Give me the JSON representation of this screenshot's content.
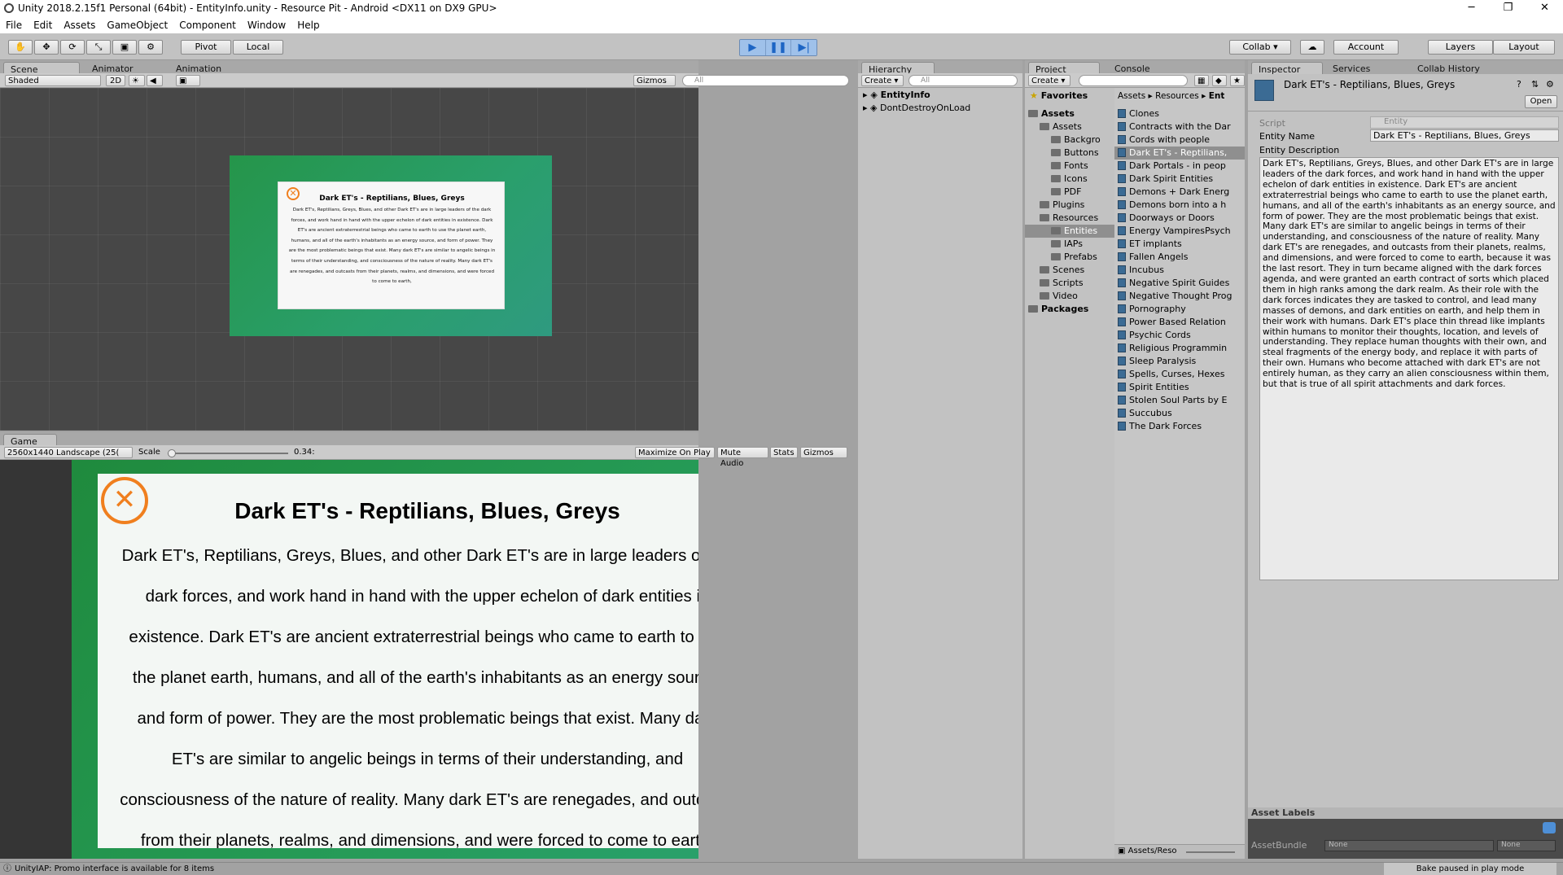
{
  "window": {
    "title": "Unity 2018.2.15f1 Personal (64bit) - EntityInfo.unity - Resource Pit - Android <DX11 on DX9 GPU>",
    "minimize": "─",
    "maximize": "❐",
    "close": "✕"
  },
  "menu": [
    "File",
    "Edit",
    "Assets",
    "GameObject",
    "Component",
    "Window",
    "Help"
  ],
  "toolbar": {
    "tools": [
      "✋",
      "✥",
      "⟳",
      "⤡",
      "▣",
      "⚙"
    ],
    "pivot": "Pivot",
    "local": "Local",
    "play": "▶",
    "pause": "❚❚",
    "step": "▶|",
    "collab": "Collab ▾",
    "cloud": "☁",
    "account": "Account",
    "layers": "Layers",
    "layout": "Layout"
  },
  "scene": {
    "tabs": [
      "Scene",
      "Animator",
      "Animation"
    ],
    "shading": "Shaded",
    "mode2d": "2D",
    "gizmos": "Gizmos ▾",
    "search": "All",
    "card_title": "Dark ET's - Reptilians, Blues, Greys",
    "card_text": "Dark ET's, Reptilians, Greys, Blues, and other Dark ET's are in large leaders of the dark forces, and work hand in hand with the upper echelon of dark entities in existence. Dark ET's are ancient extraterrestrial beings who came to earth to use the planet earth, humans, and all of the earth's inhabitants as an energy source, and form of power. They are the most problematic beings that exist. Many dark ET's are similar to angelic beings in terms of their understanding, and consciousness of the nature of reality. Many dark ET's are renegades, and outcasts from their planets, realms, and dimensions, and were forced to come to earth,"
  },
  "game": {
    "tab": "Game",
    "resolution": "2560x1440 Landscape (25(",
    "scale_label": "Scale",
    "scale_value": "0.34:",
    "toggles": [
      "Maximize On Play",
      "Mute Audio",
      "Stats",
      "Gizmos"
    ],
    "title": "Dark ET's - Reptilians, Blues, Greys",
    "lines": [
      "Dark ET's, Reptilians, Greys, Blues, and other Dark ET's are in large leaders of the",
      "dark forces, and work hand in hand with the upper echelon of dark entities in",
      "existence. Dark ET's are ancient extraterrestrial beings who came to earth to use",
      "the planet earth, humans, and all of the earth's inhabitants as an energy source,",
      "and form of power. They are the most problematic beings that exist. Many dark",
      "ET's are similar to angelic beings in terms of their understanding, and",
      "consciousness of the nature of reality. Many dark ET's are renegades, and outcasts",
      "from their planets, realms, and dimensions, and were forced to come to earth,"
    ]
  },
  "hierarchy": {
    "tab": "Hierarchy",
    "create": "Create ▾",
    "search": "All",
    "items": [
      "EntityInfo",
      "DontDestroyOnLoad"
    ]
  },
  "project": {
    "tabs": [
      "Project",
      "Console"
    ],
    "create": "Create ▾",
    "favorites": "Favorites",
    "tree": [
      {
        "label": "Assets",
        "depth": 0,
        "bold": true
      },
      {
        "label": "Assets",
        "depth": 1
      },
      {
        "label": "Backgro",
        "depth": 2
      },
      {
        "label": "Buttons",
        "depth": 2
      },
      {
        "label": "Fonts",
        "depth": 2
      },
      {
        "label": "Icons",
        "depth": 2
      },
      {
        "label": "PDF",
        "depth": 2
      },
      {
        "label": "Plugins",
        "depth": 1
      },
      {
        "label": "Resources",
        "depth": 1
      },
      {
        "label": "Entities",
        "depth": 2,
        "selected": true
      },
      {
        "label": "IAPs",
        "depth": 2
      },
      {
        "label": "Prefabs",
        "depth": 2
      },
      {
        "label": "Scenes",
        "depth": 1
      },
      {
        "label": "Scripts",
        "depth": 1
      },
      {
        "label": "Video",
        "depth": 1
      },
      {
        "label": "Packages",
        "depth": 0,
        "bold": true
      }
    ],
    "breadcrumb": [
      "Assets",
      "Resources",
      "Ent"
    ],
    "files": [
      "Clones",
      "Contracts with the Dar",
      "Cords with people",
      "Dark ET's - Reptilians,",
      "Dark Portals - in peop",
      "Dark Spirit Entities",
      "Demons + Dark Energ",
      "Demons born into a h",
      "Doorways or Doors",
      "Energy VampiresPsych",
      "ET implants",
      "Fallen Angels",
      "Incubus",
      "Negative Spirit Guides",
      "Negative Thought Prog",
      "Pornography",
      "Power Based Relation",
      "Psychic Cords",
      "Religious Programmin",
      "Sleep Paralysis",
      "Spells, Curses, Hexes",
      "Spirit Entities",
      "Stolen Soul Parts by E",
      "Succubus",
      "The Dark Forces"
    ],
    "selected_file": 3,
    "footer": "Assets/Reso"
  },
  "inspector": {
    "tabs": [
      "Inspector",
      "Services",
      "Collab History"
    ],
    "title": "Dark ET's - Reptilians, Blues, Greys",
    "open": "Open",
    "script_label": "Script",
    "script_value": "Entity",
    "name_label": "Entity Name",
    "name_value": "Dark ET's - Reptilians, Blues, Greys",
    "desc_label": "Entity Description",
    "desc_value": "Dark ET's, Reptilians, Greys, Blues, and other Dark ET's are in large leaders of the dark forces, and work hand in hand with the upper echelon of dark entities in existence. Dark ET's are ancient extraterrestrial beings who came to earth to use the planet earth, humans, and all of the earth's inhabitants as an energy source, and form of power. They are the most problematic beings that exist. Many dark ET's are similar to angelic beings in terms of their understanding, and consciousness of the nature of reality. Many dark ET's are renegades, and outcasts from their planets, realms, and dimensions, and were forced to come to earth, because it was the last resort. They in turn became aligned with the dark forces agenda, and were granted an earth contract of sorts which placed them in high ranks among the dark realm. As their role with the dark forces indicates they are tasked to control, and lead many masses of demons, and dark entities on earth, and help them in their work with humans. Dark ET's place thin thread like implants within humans to monitor their thoughts, location, and levels of understanding. They replace human thoughts with their own, and steal fragments of the energy body, and replace it with parts of their own. Humans who become attached with dark ET's are not entirely human, as they carry an alien consciousness within them, but that is true of all spirit attachments and dark forces.",
    "asset_labels": "Asset Labels",
    "asset_bundle": "AssetBundle",
    "none1": "None",
    "none2": "None"
  },
  "status": {
    "left": "UnityIAP: Promo interface is available for 8 items",
    "right": "Bake paused in play mode"
  },
  "colors": {
    "green": "#1e8a3c",
    "orange": "#f07f1e",
    "accent": "#3a72c4"
  }
}
